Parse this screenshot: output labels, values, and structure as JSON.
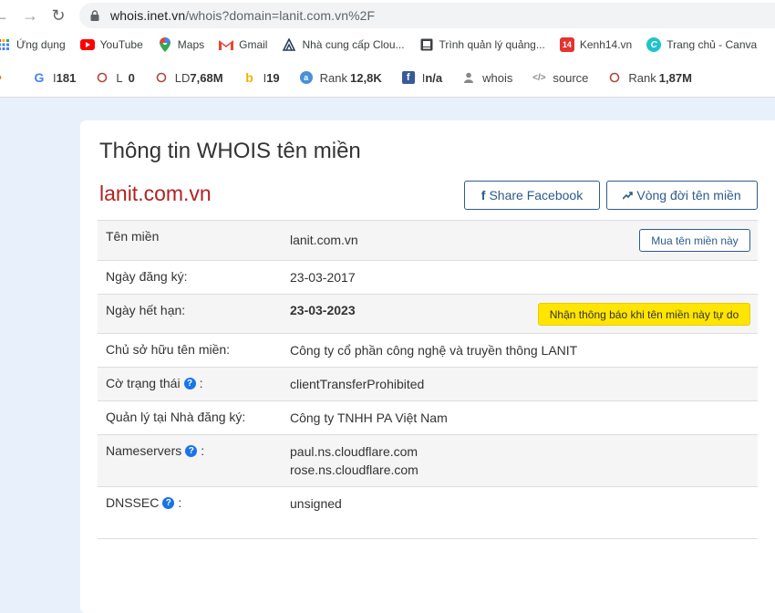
{
  "browser": {
    "url_host": "whois.inet.vn",
    "url_rest": "/whois?domain=lanit.com.vn%2F"
  },
  "bookmarks": [
    {
      "label": "Ứng dụng",
      "icon": "apps-grid-icon"
    },
    {
      "label": "YouTube",
      "icon": "youtube-icon"
    },
    {
      "label": "Maps",
      "icon": "maps-pin-icon"
    },
    {
      "label": "Gmail",
      "icon": "gmail-icon"
    },
    {
      "label": "Nhà cung cấp Clou...",
      "icon": "cloud-provider-icon"
    },
    {
      "label": "Trình quản lý quảng...",
      "icon": "ads-manager-icon"
    },
    {
      "label": "Kenh14.vn",
      "icon": "kenh14-icon"
    },
    {
      "label": "Trang chủ - Canva",
      "icon": "canva-icon"
    }
  ],
  "extensions": [
    {
      "prefix": "I",
      "value": "181",
      "icon": "google-icon"
    },
    {
      "prefix": "L",
      "value": "0",
      "icon": "circle-icon"
    },
    {
      "prefix": "LD",
      "value": "7,68M",
      "icon": "circle-icon"
    },
    {
      "prefix": "I",
      "value": "19",
      "icon": "bing-icon"
    },
    {
      "prefix": "Rank",
      "value": "12,8K",
      "icon": "alexa-icon"
    },
    {
      "prefix": "I",
      "value": "n/a",
      "icon": "facebook-icon"
    },
    {
      "prefix": "whois",
      "value": "",
      "icon": "person-icon"
    },
    {
      "prefix": "source",
      "value": "",
      "icon": "code-icon"
    },
    {
      "prefix": "Rank",
      "value": "1,87M",
      "icon": "circle-icon"
    }
  ],
  "page": {
    "title": "Thông tin WHOIS tên miền",
    "domain": "lanit.com.vn",
    "share_facebook": "Share Facebook",
    "lifecycle": "Vòng đời tên miền"
  },
  "rows": {
    "domain": {
      "label": "Tên miền",
      "value": "lanit.com.vn",
      "button": "Mua tên miền này"
    },
    "registered": {
      "label": "Ngày đăng ký:",
      "value": "23-03-2017"
    },
    "expires": {
      "label": "Ngày hết hạn:",
      "value": "23-03-2023",
      "button": "Nhận thông báo khi tên miền này tự do"
    },
    "owner": {
      "label": "Chủ sở hữu tên miền:",
      "value": "Công ty cổ phần công nghệ và truyền thông LANIT"
    },
    "status": {
      "label": "Cờ trạng thái",
      "suffix": ":",
      "value": "clientTransferProhibited"
    },
    "registrar": {
      "label": "Quản lý tại Nhà đăng ký:",
      "value": "Công ty TNHH PA Việt Nam"
    },
    "nameservers": {
      "label": "Nameservers",
      "suffix": ":",
      "values": [
        "paul.ns.cloudflare.com",
        "rose.ns.cloudflare.com"
      ]
    },
    "dnssec": {
      "label": "DNSSEC",
      "suffix": ":",
      "value": "unsigned"
    }
  }
}
